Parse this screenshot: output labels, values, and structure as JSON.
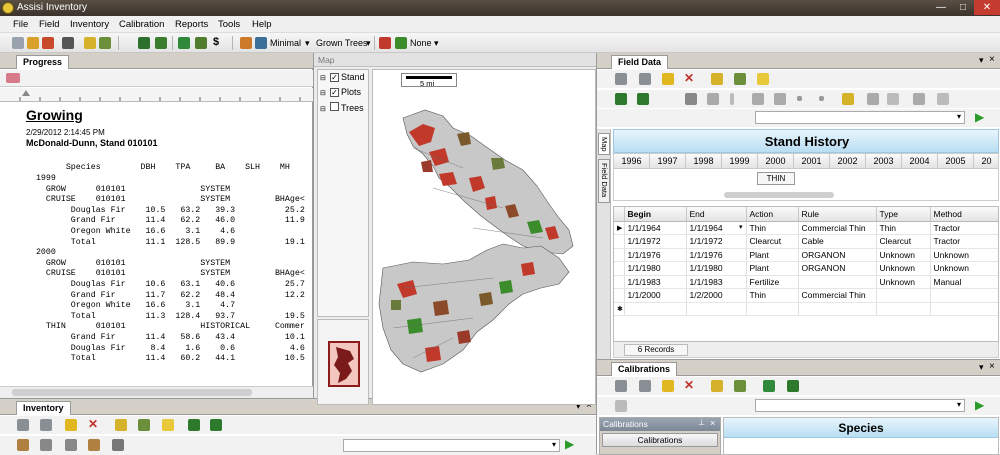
{
  "window": {
    "title": "Assisi Inventory"
  },
  "menu": [
    "File",
    "Field",
    "Inventory",
    "Calibration",
    "Reports",
    "Tools",
    "Help"
  ],
  "toolbar": {
    "view_select": "Minimal",
    "grown_select": "Grown Trees",
    "none_select": "None",
    "dollar": "$"
  },
  "progress": {
    "tab": "Progress",
    "title": "Growing",
    "timestamp": "2/29/2012 2:14:45 PM",
    "subtitle": "McDonald-Dunn, Stand 010101",
    "header": "        Species        DBH    TPA     BA    SLH    MH",
    "lines": [
      "  1999",
      "    GROW      010101               SYSTEM",
      "    CRUISE    010101               SYSTEM         BHAge<",
      "         Douglas Fir    10.5   63.2   39.3          25.2",
      "         Grand Fir      11.4   62.2   46.0          11.9",
      "         Oregon White   16.6    3.1    4.6",
      "         Total          11.1  128.5   89.9          19.1",
      "  2000",
      "    GROW      010101               SYSTEM",
      "    CRUISE    010101               SYSTEM         BHAge<",
      "         Douglas Fir    10.6   63.1   40.6          25.7",
      "         Grand Fir      11.7   62.2   48.4          12.2",
      "         Oregon White   16.6    3.1    4.7",
      "         Total          11.3  128.4   93.7          19.5",
      "    THIN      010101               HISTORICAL     Commer",
      "         Grand Fir      11.4   58.6   43.4          10.1",
      "         Douglas Fir     8.4    1.6    0.6           4.6",
      "         Total          11.4   60.2   44.1          10.5"
    ]
  },
  "inventory": {
    "tab": "Inventory"
  },
  "map": {
    "title": "Map",
    "layers": [
      {
        "label": "Stand",
        "checked": true
      },
      {
        "label": "Plots",
        "checked": true
      },
      {
        "label": "Trees",
        "checked": false
      }
    ],
    "scale": "5 mi"
  },
  "field_data": {
    "tab": "Field Data",
    "side_tabs": [
      "Map",
      "Field Data"
    ],
    "stand_history_title": "Stand History",
    "years": [
      "1996",
      "1997",
      "1998",
      "1999",
      "2000",
      "2001",
      "2002",
      "2003",
      "2004",
      "2005",
      "20"
    ],
    "timeline_label": "THIN",
    "columns": [
      "Begin",
      "End",
      "Action",
      "Rule",
      "Type",
      "Method"
    ],
    "rows": [
      [
        "1/1/1964",
        "1/1/1964",
        "Thin",
        "Commercial Thin",
        "Thin",
        "Tractor"
      ],
      [
        "1/1/1972",
        "1/1/1972",
        "Clearcut",
        "Cable",
        "Clearcut",
        "Tractor"
      ],
      [
        "1/1/1976",
        "1/1/1976",
        "Plant",
        "ORGANON",
        "Unknown",
        "Unknown"
      ],
      [
        "1/1/1980",
        "1/1/1980",
        "Plant",
        "ORGANON",
        "Unknown",
        "Unknown"
      ],
      [
        "1/1/1983",
        "1/1/1983",
        "Fertilize",
        "",
        "Unknown",
        "Manual"
      ],
      [
        "1/1/2000",
        "1/2/2000",
        "Thin",
        "Commercial Thin",
        "",
        ""
      ]
    ],
    "records": "6 Records"
  },
  "calibrations": {
    "tab": "Calibrations",
    "subpanel_title": "Calibrations",
    "subpanel_button": "Calibrations",
    "species_title": "Species"
  },
  "colors": {
    "accent": "#2a7dbd",
    "title_bar": "#3a322b",
    "map_red": "#c0392b",
    "map_green": "#3c8c2c",
    "header_blue": "#c9e6f7"
  }
}
